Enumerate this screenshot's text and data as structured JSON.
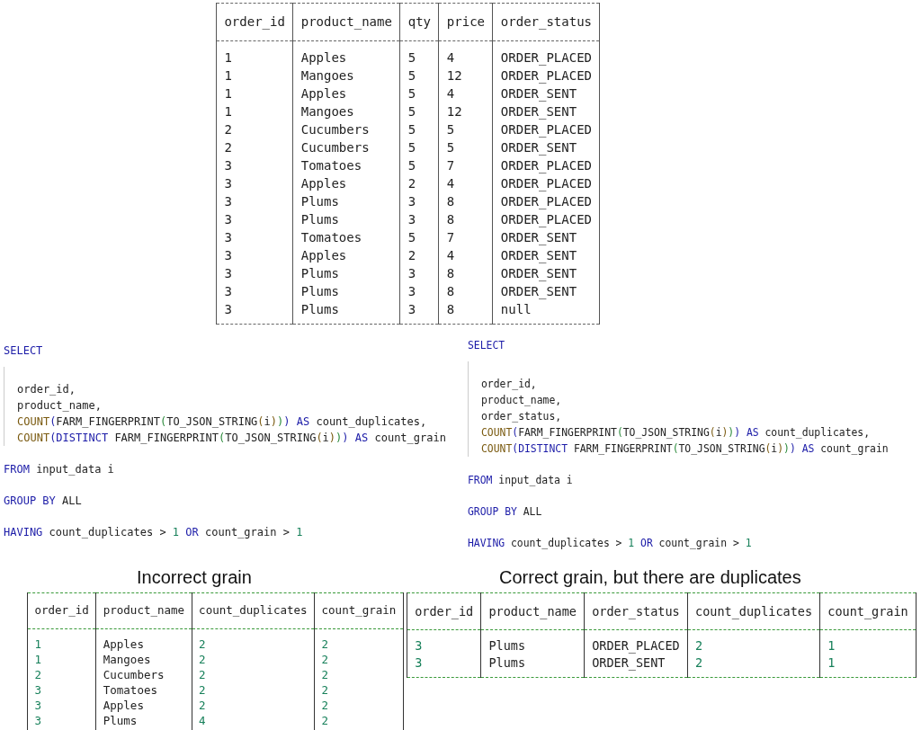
{
  "input_table": {
    "columns": [
      "order_id",
      "product_name",
      "qty",
      "price",
      "order_status"
    ],
    "rows": [
      [
        "1",
        "Apples",
        "5",
        "4",
        "ORDER_PLACED"
      ],
      [
        "1",
        "Mangoes",
        "5",
        "12",
        "ORDER_PLACED"
      ],
      [
        "1",
        "Apples",
        "5",
        "4",
        "ORDER_SENT"
      ],
      [
        "1",
        "Mangoes",
        "5",
        "12",
        "ORDER_SENT"
      ],
      [
        "2",
        "Cucumbers",
        "5",
        "5",
        "ORDER_PLACED"
      ],
      [
        "2",
        "Cucumbers",
        "5",
        "5",
        "ORDER_SENT"
      ],
      [
        "3",
        "Tomatoes",
        "5",
        "7",
        "ORDER_PLACED"
      ],
      [
        "3",
        "Apples",
        "2",
        "4",
        "ORDER_PLACED"
      ],
      [
        "3",
        "Plums",
        "3",
        "8",
        "ORDER_PLACED"
      ],
      [
        "3",
        "Plums",
        "3",
        "8",
        "ORDER_PLACED"
      ],
      [
        "3",
        "Tomatoes",
        "5",
        "7",
        "ORDER_SENT"
      ],
      [
        "3",
        "Apples",
        "2",
        "4",
        "ORDER_SENT"
      ],
      [
        "3",
        "Plums",
        "3",
        "8",
        "ORDER_SENT"
      ],
      [
        "3",
        "Plums",
        "3",
        "8",
        "ORDER_SENT"
      ],
      [
        "3",
        "Plums",
        "3",
        "8",
        "null"
      ]
    ]
  },
  "queries": [
    {
      "blocks": [
        {
          "kind": "clause",
          "tokens": [
            {
              "kind": "keyword",
              "text": "SELECT"
            }
          ]
        },
        {
          "kind": "list",
          "lines": [
            [
              {
                "kind": "plain",
                "text": "order_id,"
              }
            ],
            [
              {
                "kind": "plain",
                "text": "product_name,"
              }
            ],
            [
              {
                "kind": "function",
                "text": "COUNT"
              },
              {
                "kind": "paren1",
                "text": "("
              },
              {
                "kind": "plain",
                "text": "FARM_FINGERPRINT"
              },
              {
                "kind": "paren2",
                "text": "("
              },
              {
                "kind": "plain",
                "text": "TO_JSON_STRING"
              },
              {
                "kind": "paren3",
                "text": "("
              },
              {
                "kind": "plain",
                "text": "i"
              },
              {
                "kind": "paren3",
                "text": ")"
              },
              {
                "kind": "paren2",
                "text": ")"
              },
              {
                "kind": "paren1",
                "text": ")"
              },
              {
                "kind": "keyword",
                "text": " AS"
              },
              {
                "kind": "plain",
                "text": " count_duplicates,"
              }
            ],
            [
              {
                "kind": "function",
                "text": "COUNT"
              },
              {
                "kind": "paren1",
                "text": "("
              },
              {
                "kind": "keyword",
                "text": "DISTINCT"
              },
              {
                "kind": "plain",
                "text": " FARM_FINGERPRINT"
              },
              {
                "kind": "paren2",
                "text": "("
              },
              {
                "kind": "plain",
                "text": "TO_JSON_STRING"
              },
              {
                "kind": "paren3",
                "text": "("
              },
              {
                "kind": "plain",
                "text": "i"
              },
              {
                "kind": "paren3",
                "text": ")"
              },
              {
                "kind": "paren2",
                "text": ")"
              },
              {
                "kind": "paren1",
                "text": ")"
              },
              {
                "kind": "keyword",
                "text": " AS"
              },
              {
                "kind": "plain",
                "text": " count_grain"
              }
            ]
          ]
        },
        {
          "kind": "clause",
          "tokens": [
            {
              "kind": "keyword",
              "text": "FROM"
            },
            {
              "kind": "plain",
              "text": " input_data i"
            }
          ]
        },
        {
          "kind": "clause",
          "tokens": [
            {
              "kind": "keyword",
              "text": "GROUP BY"
            },
            {
              "kind": "plain",
              "text": " ALL"
            }
          ]
        },
        {
          "kind": "clause",
          "tokens": [
            {
              "kind": "keyword",
              "text": "HAVING"
            },
            {
              "kind": "plain",
              "text": " count_duplicates > "
            },
            {
              "kind": "number",
              "text": "1"
            },
            {
              "kind": "keyword",
              "text": " OR"
            },
            {
              "kind": "plain",
              "text": " count_grain > "
            },
            {
              "kind": "number",
              "text": "1"
            }
          ]
        }
      ]
    },
    {
      "blocks": [
        {
          "kind": "clause",
          "tokens": [
            {
              "kind": "keyword",
              "text": "SELECT"
            }
          ]
        },
        {
          "kind": "list",
          "lines": [
            [
              {
                "kind": "plain",
                "text": "order_id,"
              }
            ],
            [
              {
                "kind": "plain",
                "text": "product_name,"
              }
            ],
            [
              {
                "kind": "plain",
                "text": "order_status,"
              }
            ],
            [
              {
                "kind": "function",
                "text": "COUNT"
              },
              {
                "kind": "paren1",
                "text": "("
              },
              {
                "kind": "plain",
                "text": "FARM_FINGERPRINT"
              },
              {
                "kind": "paren2",
                "text": "("
              },
              {
                "kind": "plain",
                "text": "TO_JSON_STRING"
              },
              {
                "kind": "paren3",
                "text": "("
              },
              {
                "kind": "plain",
                "text": "i"
              },
              {
                "kind": "paren3",
                "text": ")"
              },
              {
                "kind": "paren2",
                "text": ")"
              },
              {
                "kind": "paren1",
                "text": ")"
              },
              {
                "kind": "keyword",
                "text": " AS"
              },
              {
                "kind": "plain",
                "text": " count_duplicates,"
              }
            ],
            [
              {
                "kind": "function",
                "text": "COUNT"
              },
              {
                "kind": "paren1",
                "text": "("
              },
              {
                "kind": "keyword",
                "text": "DISTINCT"
              },
              {
                "kind": "plain",
                "text": " FARM_FINGERPRINT"
              },
              {
                "kind": "paren2",
                "text": "("
              },
              {
                "kind": "plain",
                "text": "TO_JSON_STRING"
              },
              {
                "kind": "paren3",
                "text": "("
              },
              {
                "kind": "plain",
                "text": "i"
              },
              {
                "kind": "paren3",
                "text": ")"
              },
              {
                "kind": "paren2",
                "text": ")"
              },
              {
                "kind": "paren1",
                "text": ")"
              },
              {
                "kind": "keyword",
                "text": " AS"
              },
              {
                "kind": "plain",
                "text": " count_grain"
              }
            ]
          ]
        },
        {
          "kind": "clause",
          "tokens": [
            {
              "kind": "keyword",
              "text": "FROM"
            },
            {
              "kind": "plain",
              "text": " input_data i"
            }
          ]
        },
        {
          "kind": "clause",
          "tokens": [
            {
              "kind": "keyword",
              "text": "GROUP BY"
            },
            {
              "kind": "plain",
              "text": " ALL"
            }
          ]
        },
        {
          "kind": "clause",
          "tokens": [
            {
              "kind": "keyword",
              "text": "HAVING"
            },
            {
              "kind": "plain",
              "text": " count_duplicates > "
            },
            {
              "kind": "number",
              "text": "1"
            },
            {
              "kind": "keyword",
              "text": " OR"
            },
            {
              "kind": "plain",
              "text": " count_grain > "
            },
            {
              "kind": "number",
              "text": "1"
            }
          ]
        }
      ]
    }
  ],
  "results": [
    {
      "title": "Incorrect grain",
      "columns": [
        "order_id",
        "product_name",
        "count_duplicates",
        "count_grain"
      ],
      "rows": [
        [
          "1",
          "Apples",
          "2",
          "2"
        ],
        [
          "1",
          "Mangoes",
          "2",
          "2"
        ],
        [
          "2",
          "Cucumbers",
          "2",
          "2"
        ],
        [
          "3",
          "Tomatoes",
          "2",
          "2"
        ],
        [
          "3",
          "Apples",
          "2",
          "2"
        ],
        [
          "3",
          "Plums",
          "4",
          "2"
        ]
      ]
    },
    {
      "title": "Correct grain, but there are duplicates",
      "columns": [
        "order_id",
        "product_name",
        "order_status",
        "count_duplicates",
        "count_grain"
      ],
      "rows": [
        [
          "3",
          "Plums",
          "ORDER_PLACED",
          "2",
          "1"
        ],
        [
          "3",
          "Plums",
          "ORDER_SENT",
          "2",
          "1"
        ]
      ]
    }
  ]
}
